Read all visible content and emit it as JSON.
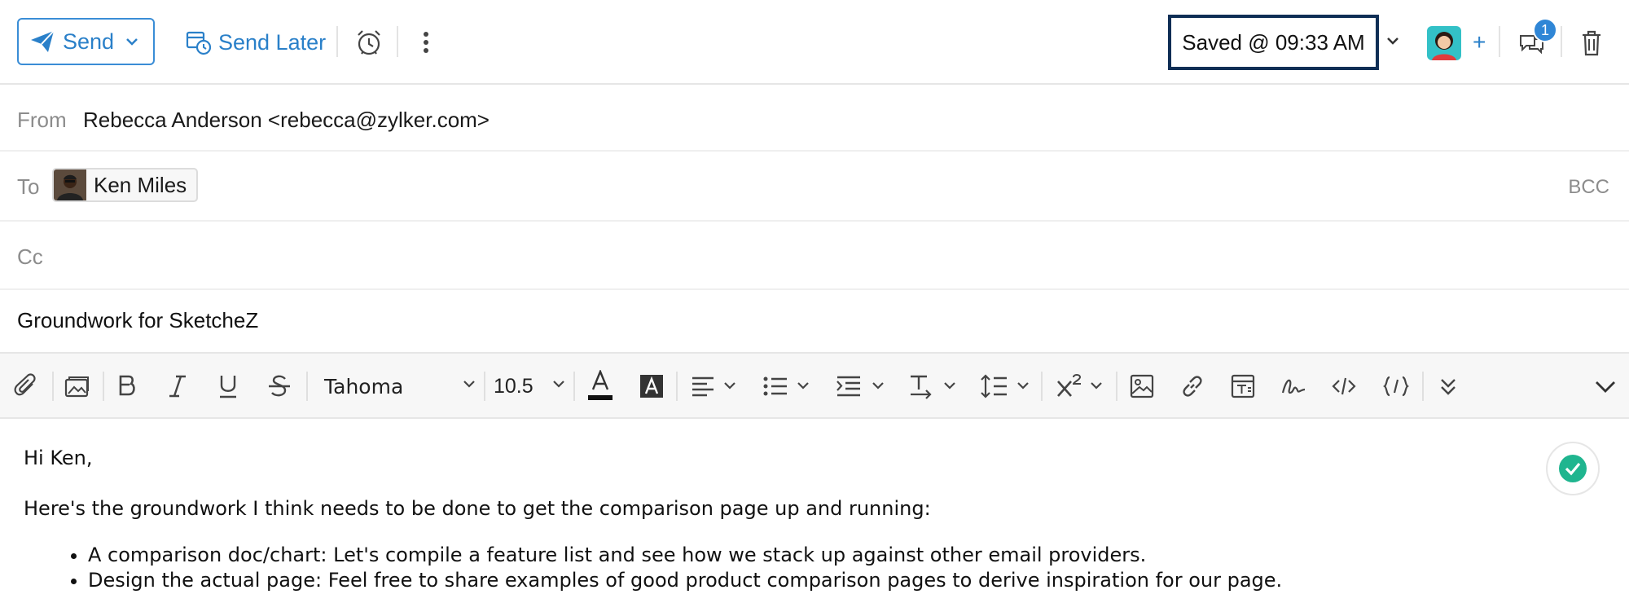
{
  "toolbar": {
    "send_label": "Send",
    "send_later_label": "Send Later",
    "saved_status": "Saved @ 09:33 AM",
    "plus_label": "+",
    "notification_count": "1"
  },
  "header": {
    "from_label": "From",
    "from_value": "Rebecca Anderson <rebecca@zylker.com>",
    "to_label": "To",
    "to_recipients": [
      {
        "name": "Ken Miles"
      }
    ],
    "bcc_label": "BCC",
    "cc_label": "Cc",
    "subject": "Groundwork for SketcheZ"
  },
  "format": {
    "font_family": "Tahoma",
    "font_size": "10.5"
  },
  "body": {
    "greeting": "Hi Ken,",
    "intro": "Here's the groundwork I think needs to be done to get the comparison page up and running:",
    "bullets": [
      "A comparison doc/chart: Let's compile a feature list and see how we stack up against other email providers.",
      "Design the actual page: Feel free to share examples of good product comparison pages to derive inspiration for our page."
    ]
  },
  "colors": {
    "accent": "#2a80c9",
    "saved_border": "#0f2e55",
    "badge": "#2f86d6",
    "success": "#1fb58f"
  }
}
